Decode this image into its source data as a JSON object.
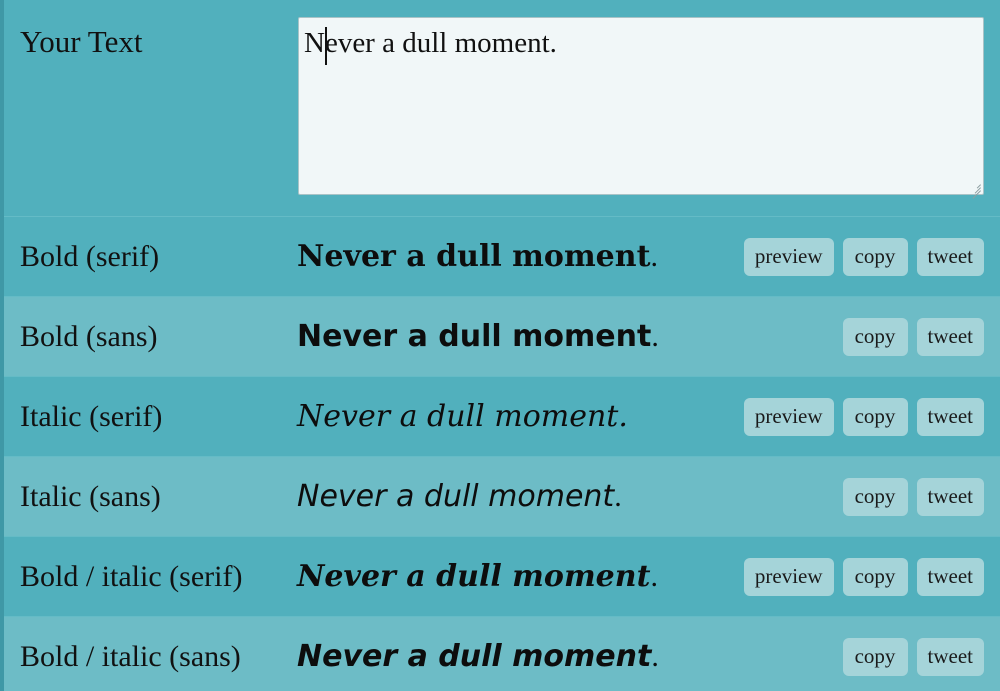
{
  "input": {
    "label": "Your Text",
    "value": "Never a dull moment.",
    "placeholder": ""
  },
  "buttons": {
    "preview": "preview",
    "copy": "copy",
    "tweet": "tweet"
  },
  "colors": {
    "page_background": "#51b0bd",
    "row_alt_background": "#6dbcc6",
    "textarea_background": "#f1f7f8",
    "button_background": "#a5d4d9",
    "text": "#111111"
  },
  "rows": [
    {
      "label": "Bold (serif)",
      "styled_text": "Never a dull moment",
      "tail": ".",
      "variant": "v-bold-serif",
      "has_preview": true,
      "shade": "shade-a"
    },
    {
      "label": "Bold (sans)",
      "styled_text": "Never a dull moment",
      "tail": ".",
      "variant": "v-bold-sans",
      "has_preview": false,
      "shade": "shade-b"
    },
    {
      "label": "Italic (serif)",
      "styled_text": "Never a dull moment.",
      "tail": "",
      "variant": "v-ital-serif",
      "has_preview": true,
      "shade": "shade-a"
    },
    {
      "label": "Italic (sans)",
      "styled_text": "Never a dull moment",
      "tail": ".",
      "variant": "v-ital-sans",
      "has_preview": false,
      "shade": "shade-b"
    },
    {
      "label": "Bold / italic (serif)",
      "styled_text": "Never a dull moment",
      "tail": ".",
      "variant": "v-bolditalic-serif",
      "has_preview": true,
      "shade": "shade-a"
    },
    {
      "label": "Bold / italic (sans)",
      "styled_text": "Never a dull moment",
      "tail": ".",
      "variant": "v-bolditalic-sans",
      "has_preview": false,
      "shade": "shade-b"
    }
  ]
}
